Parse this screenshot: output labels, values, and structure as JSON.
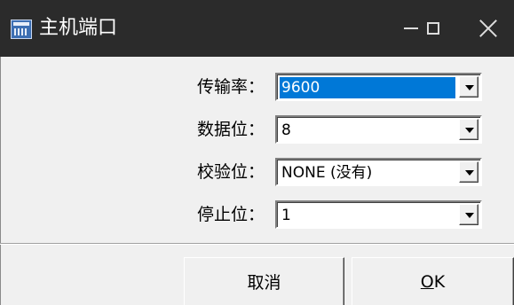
{
  "window": {
    "title": "主机端口",
    "icon": "app-window-icon",
    "controls": [
      "minimize-icon",
      "maximize-icon",
      "close-icon"
    ]
  },
  "form": {
    "baud_label": "传输率：",
    "baud_value": "9600",
    "databits_label": "数据位：",
    "databits_value": "8",
    "parity_label": "校验位：",
    "parity_value": "NONE (没有)",
    "stopbits_label": "停止位：",
    "stopbits_value": "1"
  },
  "buttons": {
    "cancel_label": "取消",
    "ok_label_underlined": "O",
    "ok_label_rest": "K"
  },
  "colors": {
    "titlebar": "#2b2b2b",
    "selection": "#0078d7",
    "background": "#f0f0f0"
  }
}
